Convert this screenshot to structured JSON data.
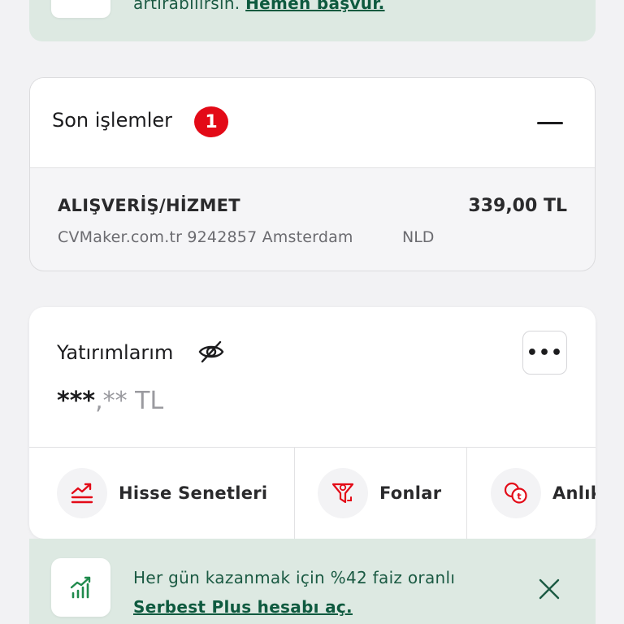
{
  "top_promo": {
    "text": "artırabilirsin.",
    "link": "Hemen başvur."
  },
  "recent_transactions": {
    "title": "Son işlemler",
    "badge_count": "1",
    "items": [
      {
        "type": "ALIŞVERİŞ/HİZMET",
        "amount": "339,00 TL",
        "description": "CVMaker.com.tr 9242857 Amsterdam",
        "country": "NLD"
      }
    ]
  },
  "investments": {
    "title": "Yatırımlarım",
    "balance_main": "***",
    "balance_rest": ",** TL",
    "more_label": "•••",
    "shortcuts": [
      {
        "label": "Hisse Senetleri",
        "icon": "stock-chart-icon"
      },
      {
        "label": "Fonlar",
        "icon": "funnel-coin-icon"
      },
      {
        "label": "Anlık",
        "icon": "coins-icon"
      }
    ]
  },
  "bottom_promo": {
    "text": "Her gün kazanmak için %42 faiz oranlı",
    "link": "Serbest Plus hesabı aç."
  },
  "colors": {
    "accent_red": "#e30a17",
    "promo_bg": "#dde9e2",
    "promo_text": "#1b5a43"
  }
}
